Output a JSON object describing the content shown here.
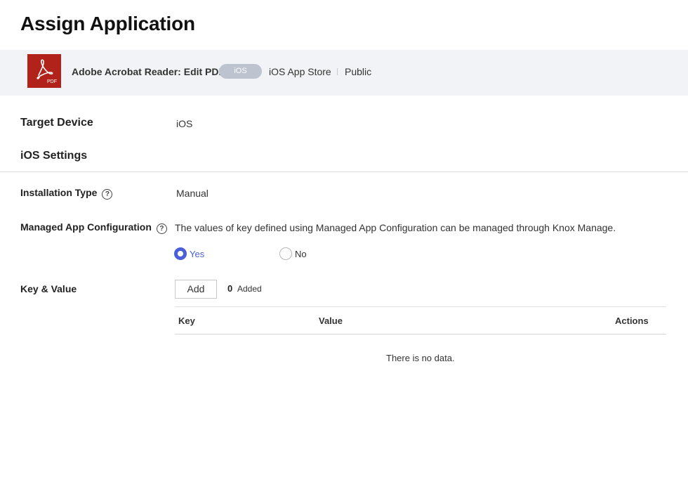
{
  "page": {
    "title": "Assign Application"
  },
  "app": {
    "name": "Adobe Acrobat Reader: Edit PDF",
    "platform_badge": "iOS",
    "store": "iOS App Store",
    "visibility": "Public",
    "icon_text": "PDF",
    "icon_color": "#b0221a"
  },
  "target_device": {
    "label": "Target Device",
    "value": "iOS"
  },
  "section": {
    "title": "iOS Settings"
  },
  "installation_type": {
    "label": "Installation Type",
    "value": "Manual",
    "help": "?"
  },
  "managed_config": {
    "label": "Managed App Configuration",
    "help": "?",
    "description": "The values of key defined using Managed App Configuration can be managed through Knox Manage.",
    "options": [
      {
        "label": "Yes",
        "selected": true
      },
      {
        "label": "No",
        "selected": false
      }
    ]
  },
  "key_value": {
    "label": "Key & Value",
    "add_button": "Add",
    "count": "0",
    "count_label": "Added",
    "columns": [
      "Key",
      "Value",
      "Actions"
    ],
    "empty_text": "There is no data."
  },
  "colors": {
    "accent": "#4a5fd9",
    "banner_bg": "#f2f3f6",
    "pill_bg": "#bdc4cf"
  }
}
